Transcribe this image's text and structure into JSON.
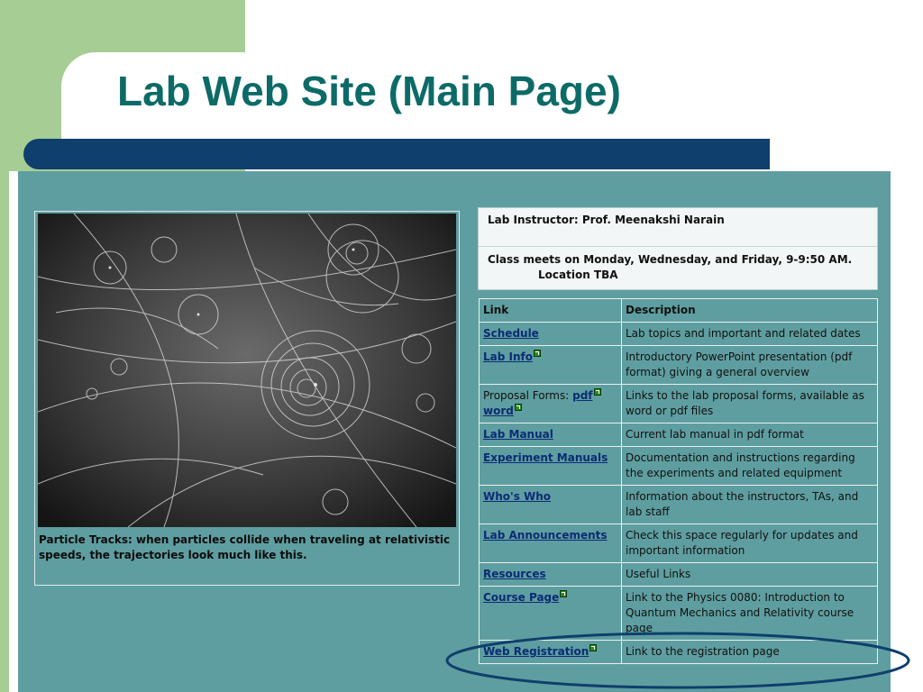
{
  "slide": {
    "title": "Lab Web Site (Main Page)",
    "colors": {
      "title": "#0d6b67",
      "accent_green": "#a6cd94",
      "bar_navy": "#0f3f6c",
      "page_teal": "#5f9ea0",
      "link_blue": "#0a2b76"
    }
  },
  "page": {
    "image": {
      "icon": "particle-tracks-photo",
      "caption_line1": "Particle Tracks: when particles collide when traveling at relativistic",
      "caption_line2": "speeds, the trajectories look much like this."
    },
    "info": {
      "instructor": "Lab Instructor: Prof. Meenakshi Narain",
      "class_meets": "Class meets on Monday, Wednesday, and Friday, 9-9:50 AM.",
      "location": "Location TBA"
    },
    "table": {
      "headers": {
        "link": "Link",
        "description": "Description"
      },
      "rows": [
        {
          "link": "Schedule",
          "description": "Lab topics and important and related dates"
        },
        {
          "link": "Lab Info",
          "description": "Introductory PowerPoint presentation (pdf format) giving a general overview"
        },
        {
          "prefix": "Proposal Forms:",
          "link": "pdf",
          "link2": "word",
          "description": "Links to the lab proposal forms, available as word or pdf files"
        },
        {
          "link": "Lab Manual",
          "description": "Current lab manual in pdf format"
        },
        {
          "link": "Experiment Manuals",
          "description": "Documentation and instructions regarding the experiments and related equipment"
        },
        {
          "link": "Who's Who",
          "description": "Information about the instructors, TAs, and lab staff"
        },
        {
          "link": "Lab Announcements",
          "description": "Check this space regularly for updates and important information"
        },
        {
          "link": "Resources",
          "description": "Useful Links"
        },
        {
          "link": "Course Page",
          "description": "Link to the Physics 0080: Introduction to Quantum Mechanics and Relativity course page"
        },
        {
          "link": "Web Registration",
          "description": "Link to the registration page"
        }
      ]
    },
    "icons": {
      "external_link": "external-link-icon"
    }
  }
}
